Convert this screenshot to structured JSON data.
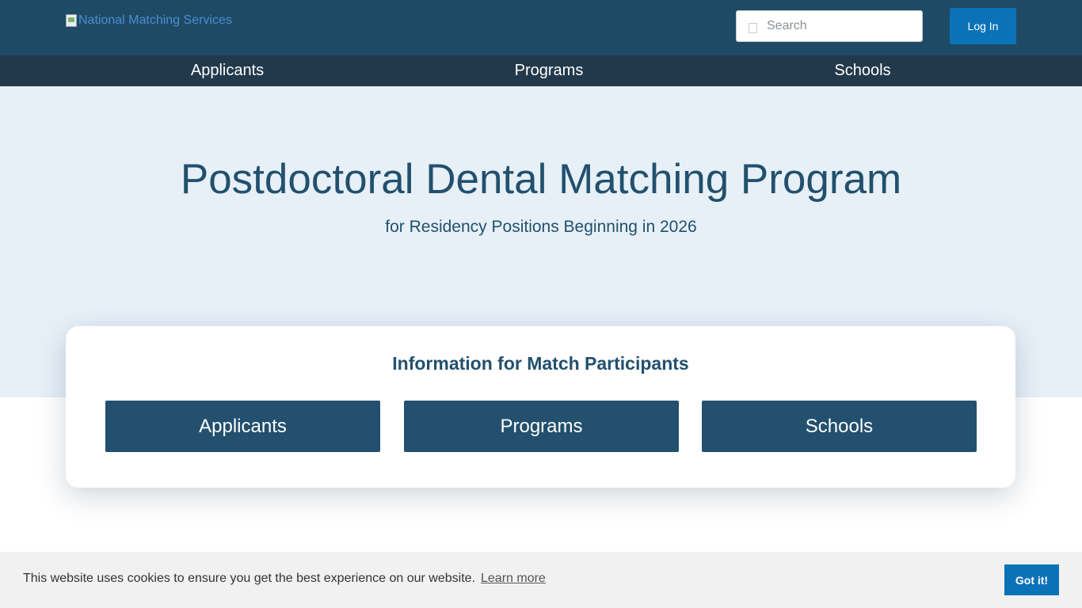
{
  "header": {
    "logo_alt": "National Matching Services",
    "search_placeholder": "Search",
    "login_label": "Log In"
  },
  "nav": {
    "items": [
      {
        "label": "Applicants"
      },
      {
        "label": "Programs"
      },
      {
        "label": "Schools"
      }
    ]
  },
  "hero": {
    "title": "Postdoctoral Dental Matching Program",
    "subtitle": "for Residency Positions Beginning in 2026"
  },
  "card": {
    "title": "Information for Match Participants",
    "buttons": [
      {
        "label": "Applicants"
      },
      {
        "label": "Programs"
      },
      {
        "label": "Schools"
      }
    ]
  },
  "cookie": {
    "text": "This website uses cookies to ensure you get the best experience on our website.",
    "link": "Learn more",
    "button": "Got it!"
  },
  "colors": {
    "header_bg": "#1f4a66",
    "nav_bg": "#22394b",
    "hero_bg": "#e7f0f7",
    "primary_text": "#22506e",
    "button_bg": "#22506e",
    "accent": "#0b72b8"
  }
}
